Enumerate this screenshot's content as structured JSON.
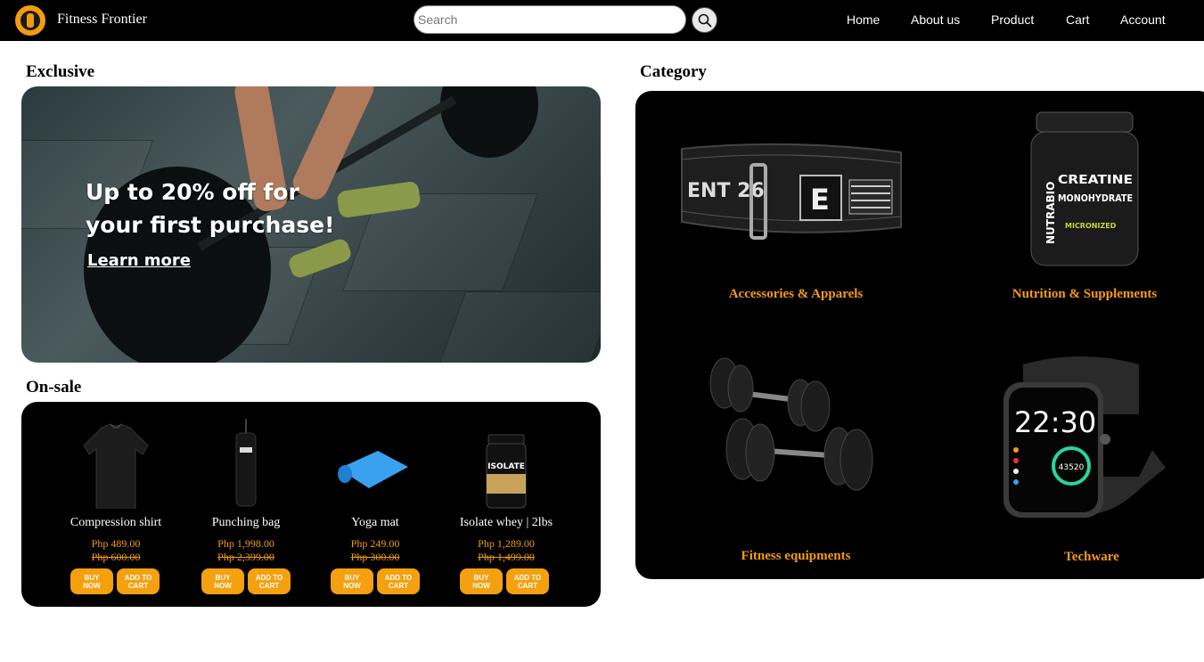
{
  "header": {
    "brand": "Fitness Frontier",
    "logo_icon": "fitness-frontier-logo",
    "search": {
      "placeholder": "Search",
      "value": ""
    },
    "search_icon": "search-icon",
    "nav": [
      "Home",
      "About us",
      "Product",
      "Cart",
      "Account"
    ]
  },
  "exclusive": {
    "title": "Exclusive",
    "banner_line1": "Up to 20% off for",
    "banner_line2": "your first purchase!",
    "learn_more": "Learn more"
  },
  "onsale": {
    "title": "On-sale",
    "products": [
      {
        "name": "Compression shirt",
        "price": "Php 489.00",
        "old_price": "Php 600.00",
        "buy": "BUY NOW",
        "add": "ADD TO CART"
      },
      {
        "name": "Punching bag",
        "price": "Php 1,998.00",
        "old_price": "Php 2,399.00",
        "buy": "BUY NOW",
        "add": "ADD TO CART"
      },
      {
        "name": "Yoga mat",
        "price": "Php 249.00",
        "old_price": "Php 300.00",
        "buy": "BUY NOW",
        "add": "ADD TO CART"
      },
      {
        "name": "Isolate whey | 2lbs",
        "price": "Php 1,289.00",
        "old_price": "Php 1,499.00",
        "buy": "BUY NOW",
        "add": "ADD TO CART"
      }
    ]
  },
  "category": {
    "title": "Category",
    "items": [
      {
        "label": "Accessories & Apparels",
        "image_text": "ENT 26"
      },
      {
        "label": "Nutrition & Supplements",
        "image_text": "CREATINE MONOHYDRATE",
        "brand_text": "NUTRABIO",
        "sub_text": "MICRONIZED"
      },
      {
        "label": "Fitness equipments"
      },
      {
        "label": "Techware",
        "watch_time": "22:30",
        "watch_steps": "43520"
      }
    ]
  },
  "colors": {
    "accent": "#f39c12",
    "button": "#f5a00e",
    "panel": "#000000"
  }
}
